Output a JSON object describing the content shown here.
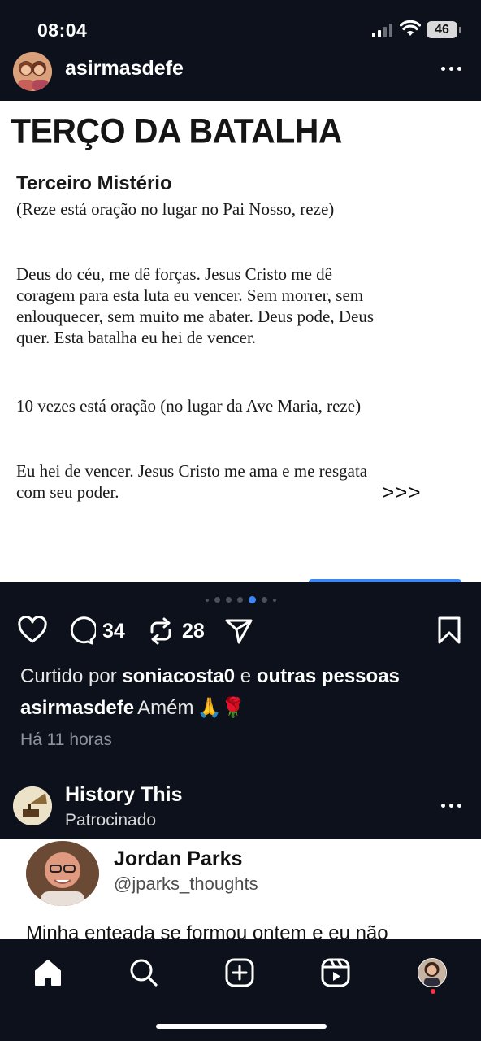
{
  "status_bar": {
    "time": "08:04",
    "battery": "46"
  },
  "post": {
    "username": "asirmasdefe",
    "image_text": {
      "title": "TERÇO DA BATALHA",
      "subtitle": "Terceiro Mistério",
      "p1": "(Reze está oração no lugar no Pai Nosso, reze)",
      "p2": "Deus do céu, me dê forças. Jesus Cristo me dê coragem para esta luta eu vencer. Sem morrer, sem enlouquecer, sem muito me abater. Deus pode, Deus quer. Esta batalha eu hei de vencer.",
      "p3": "10 vezes está oração  (no lugar da Ave Maria, reze)",
      "p4": "Eu hei de vencer. Jesus Cristo me ama e me resgata com seu poder.",
      "arrows": ">>>"
    },
    "comments_count": "34",
    "reposts_count": "28",
    "likes": {
      "prefix": "Curtido por ",
      "user": "sonia",
      "user_rest": "costa0",
      "joiner": " e ",
      "others": "outras pessoas"
    },
    "caption": {
      "user": "asirmasdefe",
      "text": "Amém",
      "emoji": "🙏🌹"
    },
    "time_ago": "Há 11 horas"
  },
  "sponsored": {
    "name": "History This",
    "label": "Patrocinado",
    "ad": {
      "name": "Jordan Parks",
      "handle": "@jparks_thoughts",
      "text": "Minha enteada se formou ontem e eu não"
    }
  },
  "colors": {
    "background": "#0c111b",
    "accent": "#3b86f6",
    "notification": "#ff3040"
  }
}
